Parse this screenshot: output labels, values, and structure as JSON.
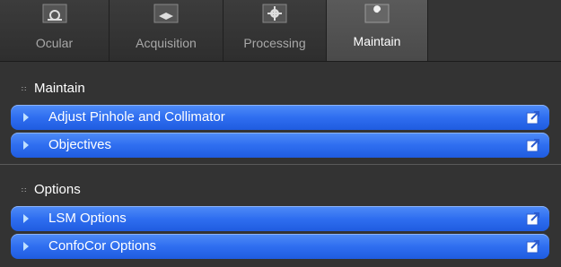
{
  "tabs": [
    {
      "label": "Ocular",
      "icon": "microscope-icon",
      "active": false
    },
    {
      "label": "Acquisition",
      "icon": "acquisition-icon",
      "active": false
    },
    {
      "label": "Processing",
      "icon": "gear-icon",
      "active": false
    },
    {
      "label": "Maintain",
      "icon": "wrench-icon",
      "active": true
    }
  ],
  "sections": [
    {
      "title": "Maintain",
      "items": [
        {
          "label": "Adjust Pinhole and Collimator"
        },
        {
          "label": "Objectives"
        }
      ]
    },
    {
      "title": "Options",
      "items": [
        {
          "label": "LSM Options"
        },
        {
          "label": "ConfoCor Options"
        }
      ]
    }
  ],
  "colors": {
    "bar_blue": "#2f6ef0",
    "background": "#333333"
  }
}
